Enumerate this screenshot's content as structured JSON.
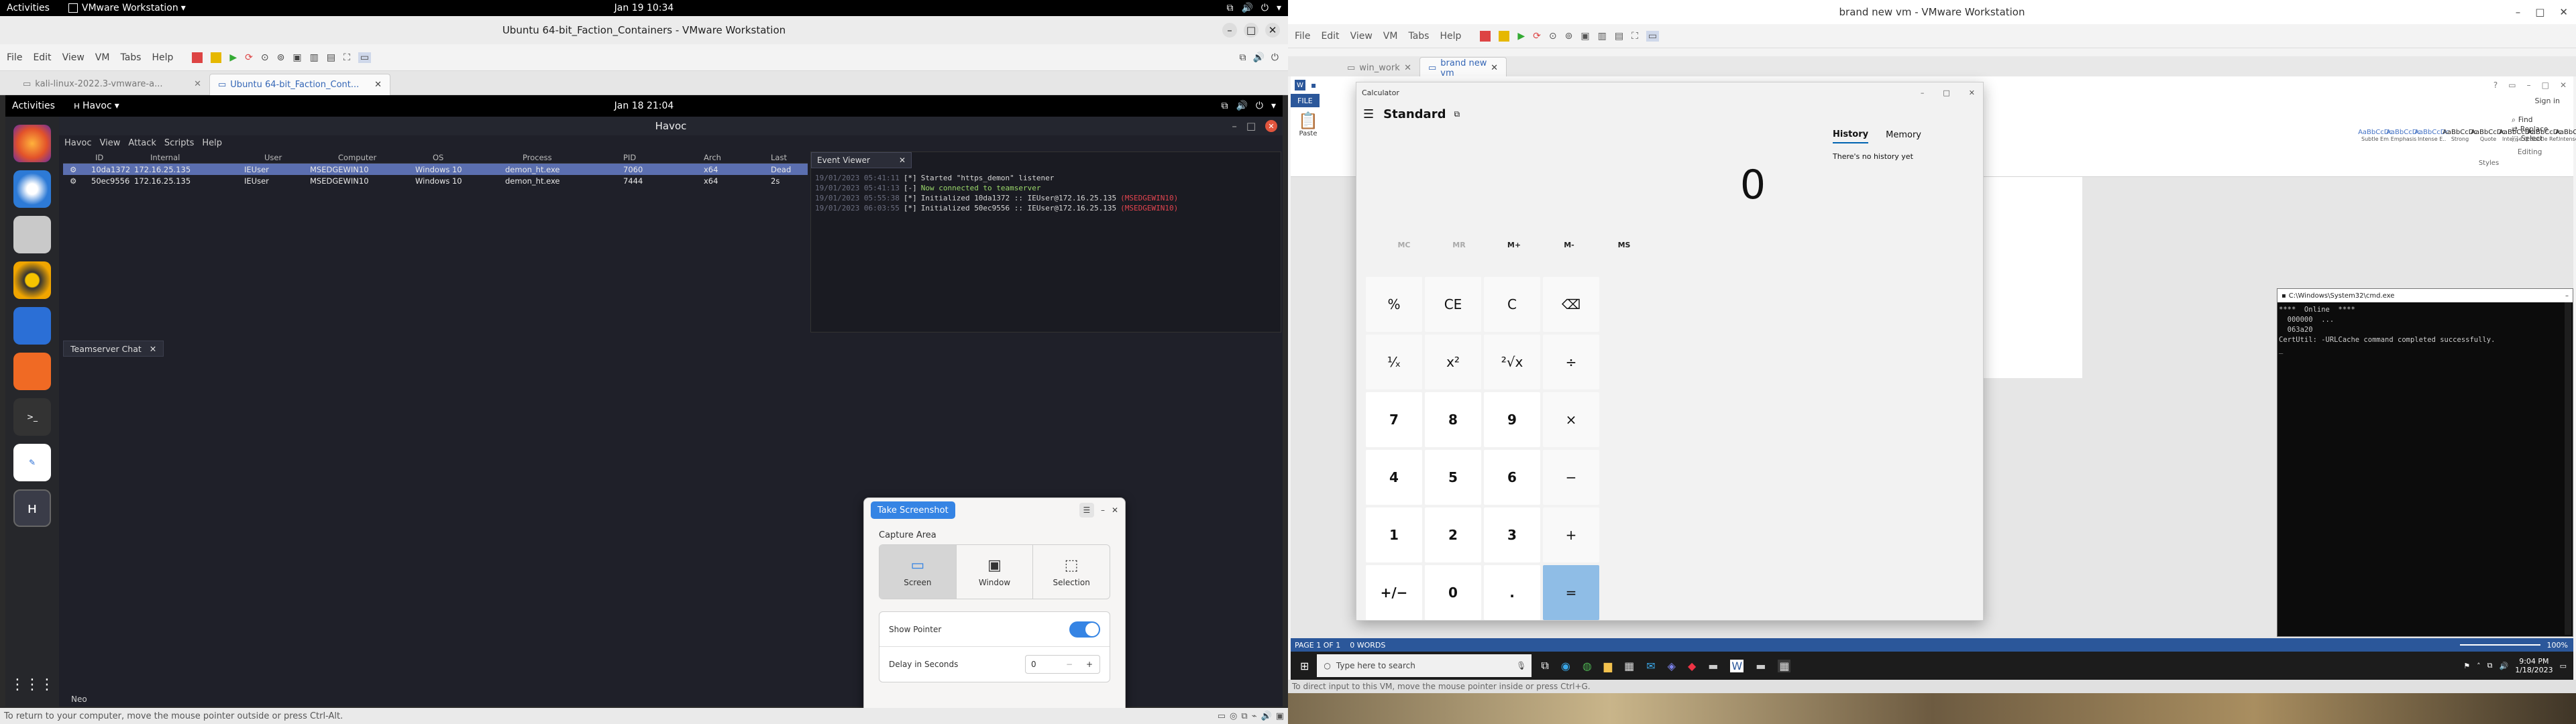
{
  "left_host": {
    "gnome_top": {
      "activities": "Activities",
      "app": "VMware Workstation",
      "clock": "Jan 19  10:34"
    },
    "vmware": {
      "title": "Ubuntu 64-bit_Faction_Containers - VMware Workstation",
      "menu": [
        "File",
        "Edit",
        "View",
        "VM",
        "Tabs",
        "Help"
      ],
      "tabs": [
        "kali-linux-2022.3-vmware-a...",
        "Ubuntu 64-bit_Faction_Cont..."
      ],
      "status": "To return to your computer, move the mouse pointer outside or press Ctrl-Alt."
    },
    "guest": {
      "top": {
        "activities": "Activities",
        "app": "Havoc",
        "clock": "Jan 18  21:04"
      },
      "havoc": {
        "title": "Havoc",
        "menu": [
          "Havoc",
          "View",
          "Attack",
          "Scripts",
          "Help"
        ],
        "session_headers": [
          "ID",
          "Internal",
          "User",
          "Computer",
          "OS",
          "Process",
          "PID",
          "Arch",
          "Last"
        ],
        "sessions": [
          [
            "10da1372",
            "172.16.25.135",
            "IEUser",
            "MSEDGEWIN10",
            "Windows 10",
            "demon_ht.exe",
            "7060",
            "x64",
            "Dead"
          ],
          [
            "50ec9556",
            "172.16.25.135",
            "IEUser",
            "MSEDGEWIN10",
            "Windows 10",
            "demon_ht.exe",
            "7444",
            "x64",
            "2s"
          ]
        ],
        "event_viewer_tab": "Event Viewer",
        "events": [
          {
            "ts": "19/01/2023 05:41:11",
            "tag": "[*]",
            "text": "Started \"https_demon\" listener",
            "color": "#d6d6d6",
            "hi": ""
          },
          {
            "ts": "19/01/2023 05:41:13",
            "tag": "[-]",
            "text": "Now connected to teamserver",
            "color": "#9bd96b",
            "hi": ""
          },
          {
            "ts": "19/01/2023 05:55:38",
            "tag": "[*]",
            "text": "Initialized 10da1372 :: IEUser@172.16.25.135",
            "color": "#d6d6d6",
            "hi": "(MSEDGEWIN10)"
          },
          {
            "ts": "19/01/2023 06:03:55",
            "tag": "[*]",
            "text": "Initialized 50ec9556 :: IEUser@172.16.25.135",
            "color": "#d6d6d6",
            "hi": "(MSEDGEWIN10)"
          }
        ],
        "chat_tab": "Teamserver Chat",
        "chat_user": "Neo"
      },
      "screenshot_dialog": {
        "button": "Take Screenshot",
        "capture_area": "Capture Area",
        "modes": [
          "Screen",
          "Window",
          "Selection"
        ],
        "show_pointer": "Show Pointer",
        "delay": "Delay in Seconds",
        "delay_value": "0"
      }
    }
  },
  "right_host": {
    "vmware": {
      "title": "brand new vm - VMware Workstation",
      "menu": [
        "File",
        "Edit",
        "View",
        "VM",
        "Tabs",
        "Help"
      ],
      "tabs": [
        "win_work",
        "brand new vm"
      ],
      "status": "To direct input to this VM, move the mouse pointer inside or press Ctrl+G."
    },
    "word": {
      "file_tab": "FILE",
      "styles": [
        "AaBbCcDc",
        "AaBbCcDc",
        "AaBbCcDc",
        "AaBbCcDc",
        "AaBbCcDc",
        "AaBbCcDc",
        "AaBbCcDc",
        "AaBbCcDc",
        "AaBbCcDc"
      ],
      "style_names": [
        "Subtle Em...",
        "Emphasis",
        "Intense E...",
        "Strong",
        "Quote",
        "Intense Q...",
        "Subtle Ref...",
        "Intense Re...",
        "Book Title"
      ],
      "styles_label": "Styles",
      "editing": [
        "Find",
        "Replace",
        "Select"
      ],
      "editing_label": "Editing",
      "sign_in": "Sign in",
      "status_page": "PAGE 1 OF 1",
      "status_words": "0 WORDS",
      "zoom": "100%"
    },
    "calculator": {
      "title": "Calculator",
      "mode": "Standard",
      "tabs": [
        "History",
        "Memory"
      ],
      "no_history": "There's no history yet",
      "display": "0",
      "memory": [
        "MC",
        "MR",
        "M+",
        "M-",
        "MS"
      ],
      "keys": [
        [
          "%",
          "CE",
          "C",
          "⌫"
        ],
        [
          "¹⁄ₓ",
          "x²",
          "²√x",
          "÷"
        ],
        [
          "7",
          "8",
          "9",
          "×"
        ],
        [
          "4",
          "5",
          "6",
          "−"
        ],
        [
          "1",
          "2",
          "3",
          "+"
        ],
        [
          "+/−",
          "0",
          ".",
          "="
        ]
      ]
    },
    "cmd": {
      "title": "C:\\Windows\\System32\\cmd.exe",
      "lines": [
        "****  Online  ****",
        "  000000  ...",
        "  063a20",
        "CertUtil: -URLCache command completed successfully.",
        "_"
      ]
    },
    "taskbar": {
      "search": "Type here to search",
      "time": "9:04 PM",
      "date": "1/18/2023"
    }
  }
}
